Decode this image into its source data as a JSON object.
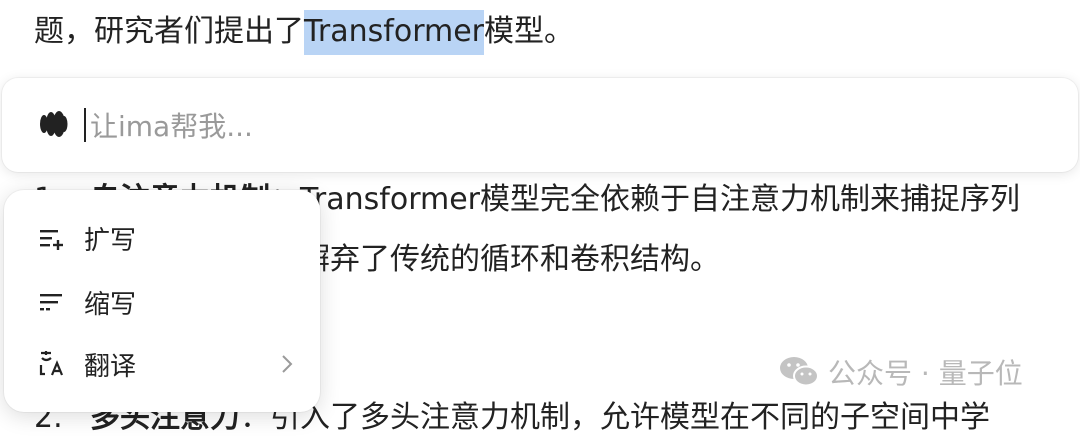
{
  "document": {
    "line_top_before": "题，研究者们提出了",
    "line_top_highlight": "Transformer",
    "line_top_after": "模型。",
    "item1_number": "1.",
    "item1_bold": "自注意力机制",
    "item1_text": "：Transformer模型完全依赖于自注意力机制来捕捉序列",
    "item1_cont": "中的依赖关系，摒弃了传统的循环和卷积结构。",
    "item2_number": "2.",
    "item2_bold": "多头注意力",
    "item2_text": "：引入了多头注意力机制，允许模型在不同的子空间中学"
  },
  "ai_bar": {
    "placeholder": "让ima帮我..."
  },
  "menu": {
    "items": [
      {
        "label": "扩写",
        "icon": "expand-text-icon"
      },
      {
        "label": "缩写",
        "icon": "shorten-text-icon"
      },
      {
        "label": "翻译",
        "icon": "translate-icon",
        "has_submenu": true
      }
    ]
  },
  "watermark": {
    "text": "公众号 · 量子位",
    "icon": "wechat-icon"
  }
}
